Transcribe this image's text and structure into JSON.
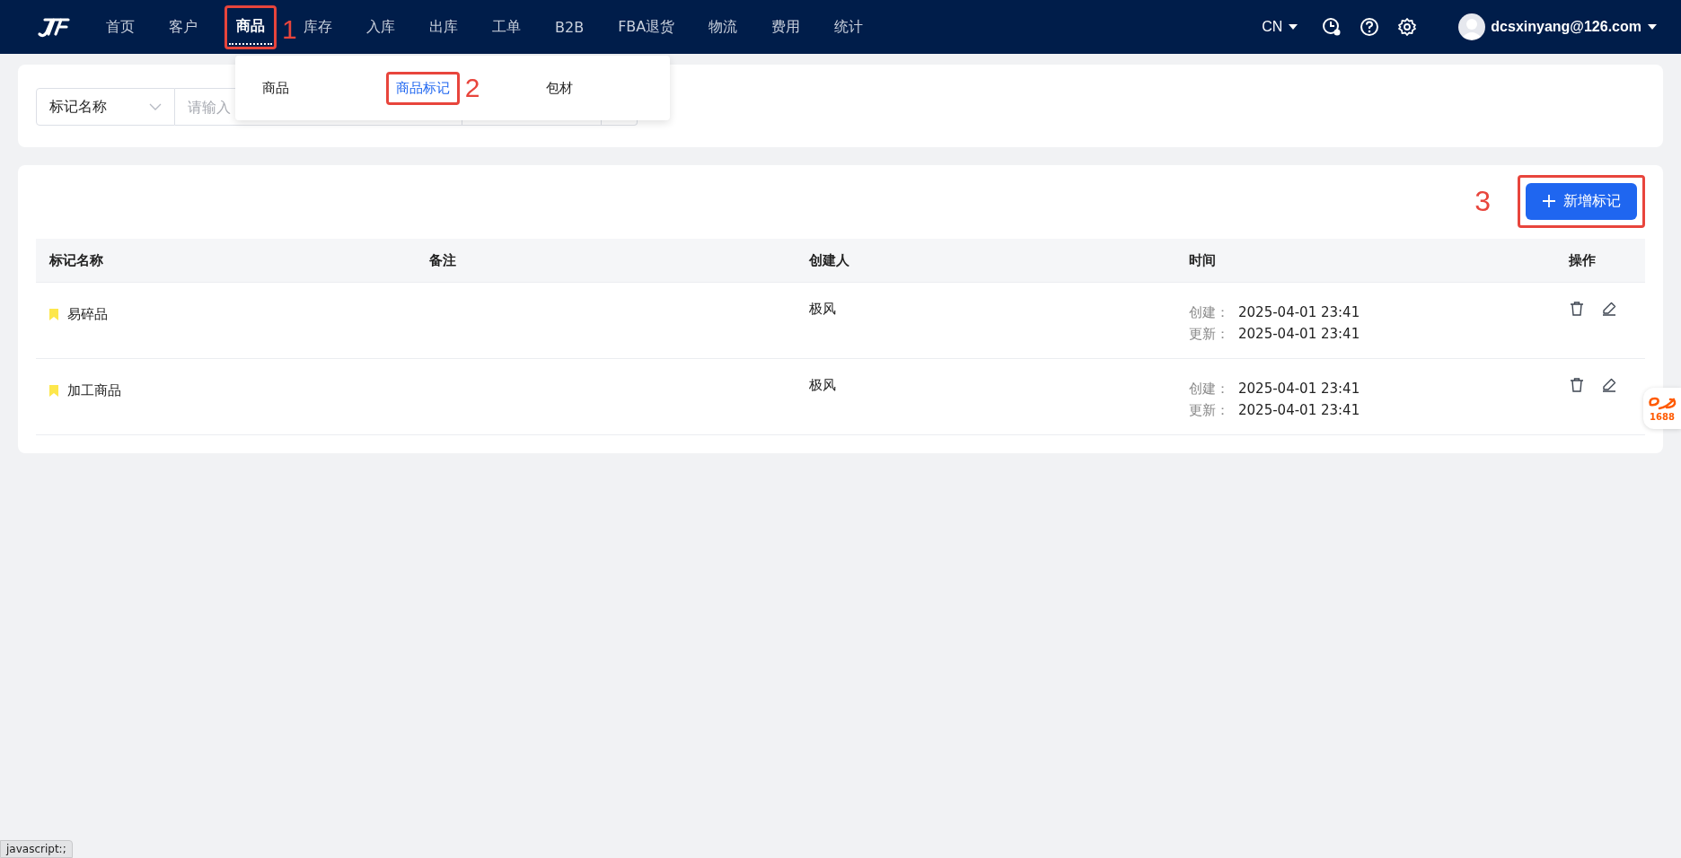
{
  "nav": {
    "items": [
      {
        "label": "首页",
        "selected": false
      },
      {
        "label": "客户",
        "selected": false
      },
      {
        "label": "商品",
        "selected": true,
        "annotation": "1"
      },
      {
        "label": "库存",
        "selected": false
      },
      {
        "label": "入库",
        "selected": false
      },
      {
        "label": "出库",
        "selected": false
      },
      {
        "label": "工单",
        "selected": false
      },
      {
        "label": "B2B",
        "selected": false
      },
      {
        "label": "FBA退货",
        "selected": false
      },
      {
        "label": "物流",
        "selected": false
      },
      {
        "label": "费用",
        "selected": false
      },
      {
        "label": "统计",
        "selected": false
      }
    ],
    "language": "CN",
    "user": "dcsxinyang@126.com"
  },
  "dropdown": {
    "items": [
      {
        "label": "商品",
        "selected": false
      },
      {
        "label": "商品标记",
        "selected": true,
        "annotation": "2"
      },
      {
        "label": "包材",
        "selected": false
      }
    ]
  },
  "filter": {
    "field_select": "标记名称",
    "search": {
      "placeholder": "请输入"
    }
  },
  "toolbar": {
    "add_button": {
      "label": "新增标记",
      "annotation": "3"
    }
  },
  "table": {
    "columns": [
      "标记名称",
      "备注",
      "创建人",
      "时间",
      "操作"
    ],
    "rows": [
      {
        "name": "易碎品",
        "color": "#fde74c",
        "creator": "极风",
        "created_label": "创建：",
        "created": "2025-04-01 23:41",
        "updated_label": "更新：",
        "updated": "2025-04-01 23:41"
      },
      {
        "name": "加工商品",
        "color": "#fde74c",
        "creator": "极风",
        "created_label": "创建：",
        "created": "2025-04-01 23:41",
        "updated_label": "更新：",
        "updated": "2025-04-01 23:41"
      }
    ]
  },
  "floating_badge": {
    "label": "1688"
  },
  "status_bar": {
    "text": "javascript:;"
  }
}
